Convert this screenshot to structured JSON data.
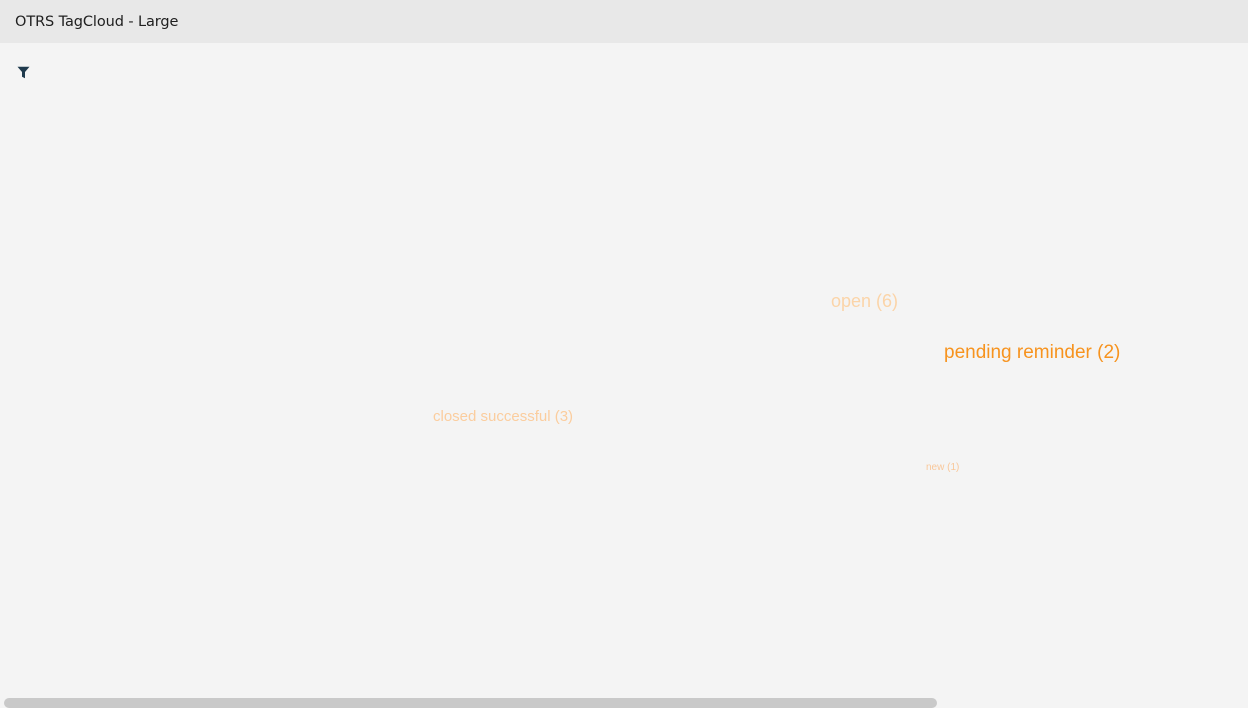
{
  "widget": {
    "title": "OTRS TagCloud - Large"
  },
  "toolbar": {
    "filter_icon": "filter-icon"
  },
  "tags": {
    "open": {
      "label": "open (6)",
      "color": "#fbd4a8"
    },
    "pending_reminder": {
      "label": "pending reminder (2)",
      "color": "#f7931e"
    },
    "closed_successful": {
      "label": "closed successful (3)",
      "color": "#fbcd9e"
    },
    "new": {
      "label": "new (1)",
      "color": "#f9c79a"
    }
  },
  "colors": {
    "header_bg": "#e8e8e8",
    "body_bg": "#f4f4f4",
    "icon": "#1f3a4d",
    "scrollbar": "#c9c9c9"
  }
}
